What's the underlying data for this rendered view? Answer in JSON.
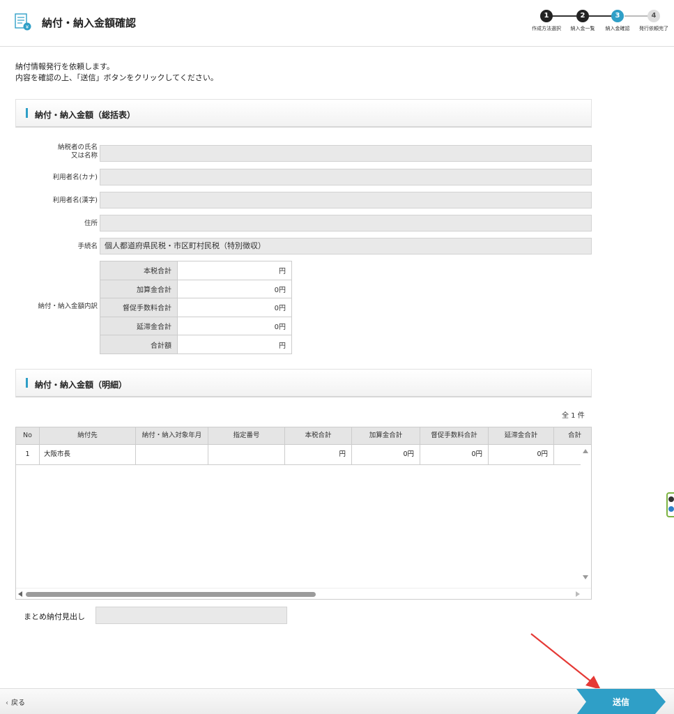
{
  "header": {
    "title": "納付・納入金額確認",
    "steps": [
      {
        "number": "1",
        "label": "作成方法選択",
        "state": "done"
      },
      {
        "number": "2",
        "label": "納入金一覧",
        "state": "done"
      },
      {
        "number": "3",
        "label": "納入金確認",
        "state": "current"
      },
      {
        "number": "4",
        "label": "発行依頼完了",
        "state": "todo"
      }
    ]
  },
  "intro": {
    "line1": "納付情報発行を依頼します。",
    "line2": "内容を確認の上、「送信」ボタンをクリックしてください。"
  },
  "summary_section": {
    "title": "納付・納入金額（総括表）",
    "fields": {
      "taxpayer_name_label_1": "納税者の氏名",
      "taxpayer_name_label_2": "又は名称",
      "taxpayer_name_value": "",
      "user_kana_label": "利用者名(カナ)",
      "user_kana_value": "",
      "user_kanji_label": "利用者名(漢字)",
      "user_kanji_value": "",
      "address_label": "住所",
      "address_value": "",
      "procedure_label": "手続名",
      "procedure_value": "個人都道府県民税・市区町村民税（特別徴収）",
      "breakdown_label": "納付・納入金額内訳"
    },
    "breakdown": [
      {
        "label": "本税合計",
        "value": "円"
      },
      {
        "label": "加算金合計",
        "value": "0円"
      },
      {
        "label": "督促手数料合計",
        "value": "0円"
      },
      {
        "label": "延滞金合計",
        "value": "0円"
      },
      {
        "label": "合計額",
        "value": "円"
      }
    ]
  },
  "detail_section": {
    "title": "納付・納入金額（明細）",
    "count": "全 1 件",
    "columns": [
      "No",
      "納付先",
      "納付・納入対象年月",
      "指定番号",
      "本税合計",
      "加算金合計",
      "督促手数料合計",
      "延滞金合計",
      "合計"
    ],
    "rows": [
      {
        "no": "1",
        "dest": "大阪市長",
        "period": "",
        "number": "",
        "tax": "円",
        "add": "0円",
        "fee": "0円",
        "late": "0円",
        "total": ""
      }
    ]
  },
  "summary_heading": {
    "label": "まとめ納付見出し",
    "value": ""
  },
  "footer": {
    "back_label": "戻る",
    "send_label": "送信"
  },
  "colors": {
    "accent": "#2f9fc7",
    "send_button": "#2f9fc7",
    "arrow": "#e53935"
  }
}
